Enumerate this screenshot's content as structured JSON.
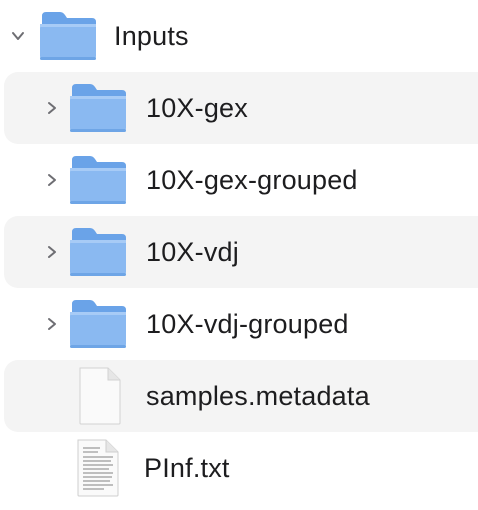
{
  "root": {
    "name": "Inputs",
    "icon": "folder-icon",
    "expanded": true,
    "disclosure_icon": "chevron-down-icon"
  },
  "items": [
    {
      "name": "10X-gex",
      "icon": "folder-icon",
      "disclosure_icon": "chevron-right-icon"
    },
    {
      "name": "10X-gex-grouped",
      "icon": "folder-icon",
      "disclosure_icon": "chevron-right-icon"
    },
    {
      "name": "10X-vdj",
      "icon": "folder-icon",
      "disclosure_icon": "chevron-right-icon"
    },
    {
      "name": "10X-vdj-grouped",
      "icon": "folder-icon",
      "disclosure_icon": "chevron-right-icon"
    },
    {
      "name": "samples.metadata",
      "icon": "blank-document-icon"
    },
    {
      "name": "PInf.txt",
      "icon": "text-document-icon"
    }
  ],
  "colors": {
    "folder_body": "#8ab9f1",
    "folder_tab": "#6aa3e8",
    "folder_edge": "#5b95dd",
    "row_stripe": "#f4f4f4",
    "chevron": "#6e6e73"
  }
}
